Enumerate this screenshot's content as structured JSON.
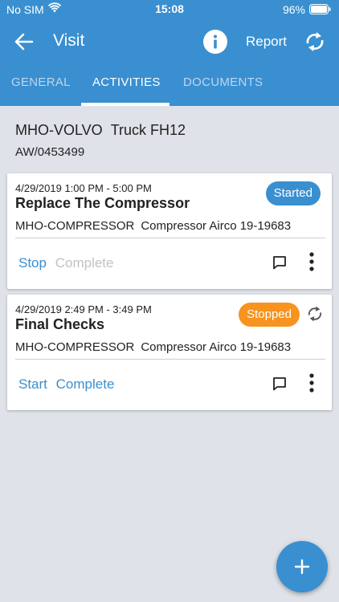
{
  "status_bar": {
    "carrier": "No SIM",
    "time": "15:08",
    "battery": "96%"
  },
  "app_bar": {
    "title": "Visit",
    "report_label": "Report"
  },
  "tabs": [
    {
      "label": "GENERAL"
    },
    {
      "label": "ACTIVITIES"
    },
    {
      "label": "DOCUMENTS"
    }
  ],
  "visit": {
    "vehicle_code": "MHO-VOLVO",
    "vehicle_model": "Truck FH12",
    "order_number": "AW/0453499"
  },
  "activities": [
    {
      "time_range": "4/29/2019 1:00 PM - 5:00 PM",
      "title": "Replace The Compressor",
      "status": "Started",
      "component_code": "MHO-COMPRESSOR",
      "component_name": "Compressor Airco 19-19683",
      "primary_action": "Stop",
      "secondary_action": "Complete"
    },
    {
      "time_range": "4/29/2019 2:49 PM - 3:49 PM",
      "title": "Final Checks",
      "status": "Stopped",
      "component_code": "MHO-COMPRESSOR",
      "component_name": "Compressor Airco 19-19683",
      "primary_action": "Start",
      "secondary_action": "Complete"
    }
  ],
  "colors": {
    "primary": "#3a8fd0",
    "started": "#3a8fd0",
    "stopped": "#f7931e",
    "background": "#dfe2e8"
  },
  "icons": {
    "back": "arrow-left-icon",
    "info": "info-icon",
    "sync": "sync-icon",
    "comment": "comment-icon",
    "more": "more-vertical-icon",
    "add": "plus-icon"
  }
}
